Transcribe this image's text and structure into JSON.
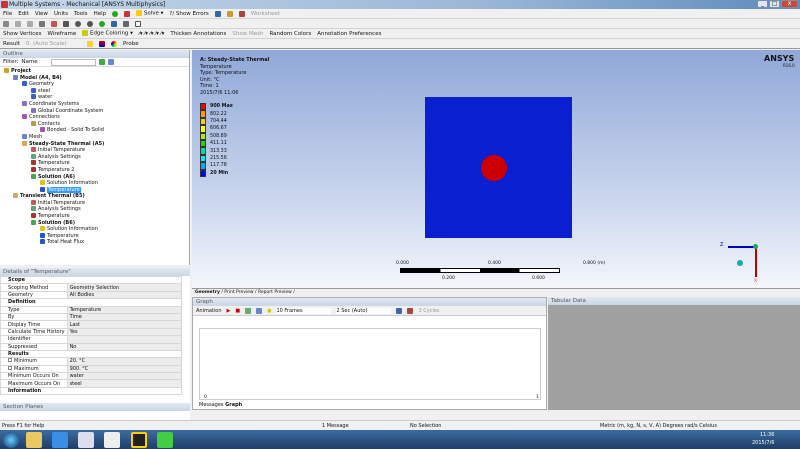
{
  "window": {
    "title": "Multiple Systems - Mechanical [ANSYS Multiphysics]"
  },
  "menu": [
    "File",
    "Edit",
    "View",
    "Units",
    "Tools",
    "Help"
  ],
  "toolbar1": {
    "solve": "Solve",
    "show_errors": "?/ Show Errors",
    "worksheet": "Worksheet"
  },
  "toolbar3": {
    "show_vertices": "Show Vertices",
    "wireframe": "Wireframe",
    "edge_coloring": "Edge Coloring",
    "thicken": "Thicken Annotations",
    "show_mesh": "Show Mesh",
    "random_colors": "Random Colors",
    "annotation_prefs": "Annotation Preferences"
  },
  "toolbar4": {
    "result_label": "Result",
    "result_value": "0. (Auto Scale)",
    "probe": "Probe"
  },
  "outline": {
    "header": "Outline",
    "filter_label": "Filter:",
    "filter_value": "Name",
    "items": [
      {
        "label": "Project",
        "level": 0,
        "bold": true,
        "color": "#c9a227"
      },
      {
        "label": "Model (A4, B4)",
        "level": 1,
        "bold": true,
        "color": "#6f7fc9"
      },
      {
        "label": "Geometry",
        "level": 2,
        "color": "#3a5fcd"
      },
      {
        "label": "steel",
        "level": 3,
        "color": "#3a5fcd"
      },
      {
        "label": "water",
        "level": 3,
        "color": "#3a5fcd"
      },
      {
        "label": "Coordinate Systems",
        "level": 2,
        "color": "#8a6fc9"
      },
      {
        "label": "Global Coordinate System",
        "level": 3,
        "color": "#8a6fc9"
      },
      {
        "label": "Connections",
        "level": 2,
        "color": "#9a59b5"
      },
      {
        "label": "Contacts",
        "level": 3,
        "color": "#b5a040"
      },
      {
        "label": "Bonded - Solid To Solid",
        "level": 4,
        "color": "#9a59b5"
      },
      {
        "label": "Mesh",
        "level": 2,
        "color": "#6f7fc9"
      },
      {
        "label": "Steady-State Thermal (A5)",
        "level": 2,
        "bold": true,
        "color": "#d9a85c"
      },
      {
        "label": "Initial Temperature",
        "level": 3,
        "color": "#cc5555"
      },
      {
        "label": "Analysis Settings",
        "level": 3,
        "color": "#55aa77"
      },
      {
        "label": "Temperature",
        "level": 3,
        "color": "#b03030"
      },
      {
        "label": "Temperature 2",
        "level": 3,
        "color": "#b03030"
      },
      {
        "label": "Solution (A6)",
        "level": 3,
        "bold": true,
        "color": "#44aa44"
      },
      {
        "label": "Solution Information",
        "level": 4,
        "color": "#e0c020"
      },
      {
        "label": "Temperature",
        "level": 4,
        "selected": true,
        "color": "#2255cc"
      },
      {
        "label": "Transient Thermal (B5)",
        "level": 1,
        "bold": true,
        "color": "#d9a85c"
      },
      {
        "label": "Initial Temperature",
        "level": 3,
        "color": "#cc5555"
      },
      {
        "label": "Analysis Settings",
        "level": 3,
        "color": "#55aa77"
      },
      {
        "label": "Temperature",
        "level": 3,
        "color": "#b03030"
      },
      {
        "label": "Solution (B6)",
        "level": 3,
        "bold": true,
        "color": "#44aa44"
      },
      {
        "label": "Solution Information",
        "level": 4,
        "color": "#e0c020"
      },
      {
        "label": "Temperature",
        "level": 4,
        "color": "#2255cc"
      },
      {
        "label": "Total Heat Flux",
        "level": 4,
        "color": "#2255cc"
      }
    ]
  },
  "details": {
    "header": "Details of \"Temperature\"",
    "rows": [
      {
        "section": "Scope"
      },
      {
        "k": "Scoping Method",
        "v": "Geometry Selection"
      },
      {
        "k": "Geometry",
        "v": "All Bodies"
      },
      {
        "section": "Definition"
      },
      {
        "k": "Type",
        "v": "Temperature"
      },
      {
        "k": "By",
        "v": "Time"
      },
      {
        "k": "Display Time",
        "v": "Last"
      },
      {
        "k": "Calculate Time History",
        "v": "Yes"
      },
      {
        "k": "Identifier",
        "v": ""
      },
      {
        "k": "Suppressed",
        "v": "No"
      },
      {
        "section": "Results"
      },
      {
        "k": "Minimum",
        "v": "20. °C",
        "check": true
      },
      {
        "k": "Maximum",
        "v": "900. °C",
        "check": true
      },
      {
        "k": "Minimum Occurs On",
        "v": "water"
      },
      {
        "k": "Maximum Occurs On",
        "v": "steel"
      },
      {
        "section": "Information"
      }
    ]
  },
  "section_planes": {
    "header": "Section Planes"
  },
  "viewport": {
    "title": "A: Steady-State Thermal",
    "lines": [
      "Temperature",
      "Type: Temperature",
      "Unit: °C",
      "Time: 1",
      "2015/7/6 11:06"
    ],
    "legend": [
      {
        "label": "900 Max",
        "color": "#ff0000"
      },
      {
        "label": "802.22",
        "color": "#ff9900"
      },
      {
        "label": "704.44",
        "color": "#ffcc00"
      },
      {
        "label": "606.67",
        "color": "#ffff00"
      },
      {
        "label": "508.89",
        "color": "#aaee00"
      },
      {
        "label": "411.11",
        "color": "#33cc00"
      },
      {
        "label": "313.33",
        "color": "#00dd99"
      },
      {
        "label": "215.56",
        "color": "#00eeee"
      },
      {
        "label": "117.78",
        "color": "#00aaee"
      },
      {
        "label": "20 Min",
        "color": "#0000ff"
      }
    ],
    "logo": "ANSYS",
    "logo_version": "R16.0",
    "scale_top": [
      "0.000",
      "0.400",
      "0.800 (m)"
    ],
    "scale_bottom": [
      "0.200",
      "0.600"
    ],
    "triad": {
      "z": "Z",
      "x": "X"
    },
    "body_color": "#0a1fd0",
    "hotspot_color": "#cc0000"
  },
  "view_tabs": [
    "Geometry",
    "Print Preview",
    "Report Preview"
  ],
  "graph": {
    "header": "Graph",
    "animation": "Animation",
    "frames": "10 Frames",
    "duration": "2 Sec (Auto)",
    "cycles": "3 Cycles",
    "x_start": "0",
    "x_end": "1",
    "tabs": [
      "Messages",
      "Graph"
    ]
  },
  "tabular": {
    "header": "Tabular Data"
  },
  "status": {
    "help": "Press F1 for Help",
    "messages": "1 Message",
    "selection": "No Selection",
    "units": "Metric (m, kg, N, s, V, A)  Degrees  rad/s  Celsius"
  },
  "taskbar": {
    "time": "11:36",
    "date": "2015/7/6"
  }
}
